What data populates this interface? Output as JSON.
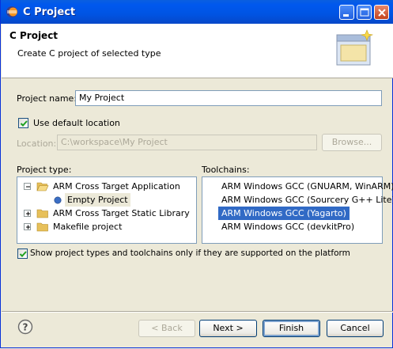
{
  "window": {
    "title": "C Project"
  },
  "header": {
    "title": "C Project",
    "description": "Create C project of selected type"
  },
  "project_name": {
    "label": "Project name:",
    "value": "My Project"
  },
  "default_location": {
    "label": "Use default location",
    "checked": true
  },
  "location": {
    "label": "Location:",
    "value": "C:\\workspace\\My Project",
    "browse_label": "Browse..."
  },
  "project_type": {
    "label": "Project type:",
    "items": [
      {
        "label": "ARM Cross Target Application",
        "expanded": true
      },
      {
        "label": "Empty Project",
        "selected": true
      },
      {
        "label": "ARM Cross Target Static Library",
        "expanded": false
      },
      {
        "label": "Makefile project",
        "expanded": false
      }
    ]
  },
  "toolchains": {
    "label": "Toolchains:",
    "items": [
      {
        "label": "ARM Windows GCC (GNUARM, WinARM)"
      },
      {
        "label": "ARM Windows GCC (Sourcery G++ Lite)"
      },
      {
        "label": "ARM Windows GCC (Yagarto)",
        "selected": true
      },
      {
        "label": "ARM Windows GCC (devkitPro)"
      }
    ]
  },
  "filter": {
    "label": "Show project types and toolchains only if they are supported on the platform",
    "checked": true
  },
  "buttons": {
    "back": "< Back",
    "next": "Next >",
    "finish": "Finish",
    "cancel": "Cancel"
  },
  "colors": {
    "titlebar": "#0054E3",
    "selection": "#316AC5",
    "dialog_bg": "#ECE9D8"
  }
}
